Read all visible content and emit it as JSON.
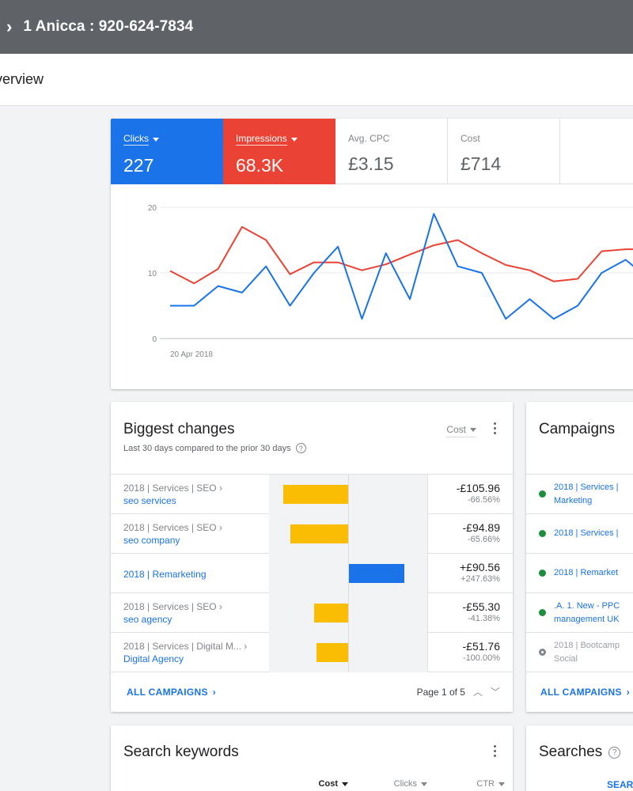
{
  "header": {
    "account": "1 Anicca : 920-624-7834",
    "page_title": "verview"
  },
  "metrics": [
    {
      "label": "Clicks",
      "value": "227",
      "color": "#1a73e8",
      "dropdown": true
    },
    {
      "label": "Impressions",
      "value": "68.3K",
      "color": "#ea4335",
      "dropdown": true
    },
    {
      "label": "Avg. CPC",
      "value": "£3.15"
    },
    {
      "label": "Cost",
      "value": "£714"
    }
  ],
  "chart_data": {
    "type": "line",
    "x_start_label": "20 Apr 2018",
    "yticks": [
      0,
      10,
      20
    ],
    "ylim": [
      0,
      20
    ],
    "series": [
      {
        "name": "Clicks",
        "color": "#1a73e8",
        "values": [
          5,
          5,
          8,
          7,
          11,
          5,
          10,
          14,
          3,
          13,
          6,
          19,
          11,
          10,
          3,
          6,
          3,
          5,
          10,
          12,
          9
        ]
      },
      {
        "name": "Impressions",
        "color": "#ea4335",
        "values": [
          10.3,
          8.4,
          10.6,
          17,
          15,
          9.8,
          11.6,
          11.6,
          10.4,
          11.3,
          12.8,
          14.2,
          15,
          13,
          11.2,
          10.4,
          8.7,
          9.1,
          13.3,
          13.6,
          13.6
        ]
      }
    ]
  },
  "biggest_changes": {
    "title": "Biggest changes",
    "subtitle": "Last 30 days compared to the prior 30 days",
    "metric": "Cost",
    "rows": [
      {
        "path": "2018 | Services | SEO ›",
        "name": "seo services",
        "value": "-£105.96",
        "pct": "-66.56%",
        "amount": -105.96
      },
      {
        "path": "2018 | Services | SEO ›",
        "name": "seo company",
        "value": "-£94.89",
        "pct": "-65.66%",
        "amount": -94.89
      },
      {
        "path": "",
        "name": "2018 | Remarketing",
        "value": "+£90.56",
        "pct": "+247.63%",
        "amount": 90.56
      },
      {
        "path": "2018 | Services | SEO ›",
        "name": "seo agency",
        "value": "-£55.30",
        "pct": "-41.38%",
        "amount": -55.3
      },
      {
        "path": "2018 | Services | Digital M... ›",
        "name": "Digital Agency",
        "value": "-£51.76",
        "pct": "-100.00%",
        "amount": -51.76
      }
    ],
    "colors": {
      "negative": "#fbbc04",
      "positive": "#1a73e8"
    },
    "footer_link": "ALL CAMPAIGNS",
    "pager": "Page 1 of 5"
  },
  "campaigns": {
    "title": "Campaigns",
    "items": [
      {
        "line1": "2018 | Services |",
        "line2": "Marketing",
        "status": "#1e8e3e"
      },
      {
        "line1": "2018 | Services |",
        "line2": "",
        "status": "#1e8e3e"
      },
      {
        "line1": "2018 | Remarket",
        "line2": "",
        "status": "#1e8e3e"
      },
      {
        "line1": ".A. 1. New - PPC",
        "line2": "management UK",
        "status": "#1e8e3e"
      },
      {
        "line1": "2018 | Bootcamp",
        "line2": "Social",
        "status": "#80868b",
        "paused": true
      }
    ],
    "footer_link": "ALL CAMPAIGNS"
  },
  "search_keywords": {
    "title": "Search keywords",
    "columns": [
      "Cost",
      "Clicks",
      "CTR"
    ]
  },
  "searches": {
    "title": "Searches",
    "link": "SEAR"
  }
}
